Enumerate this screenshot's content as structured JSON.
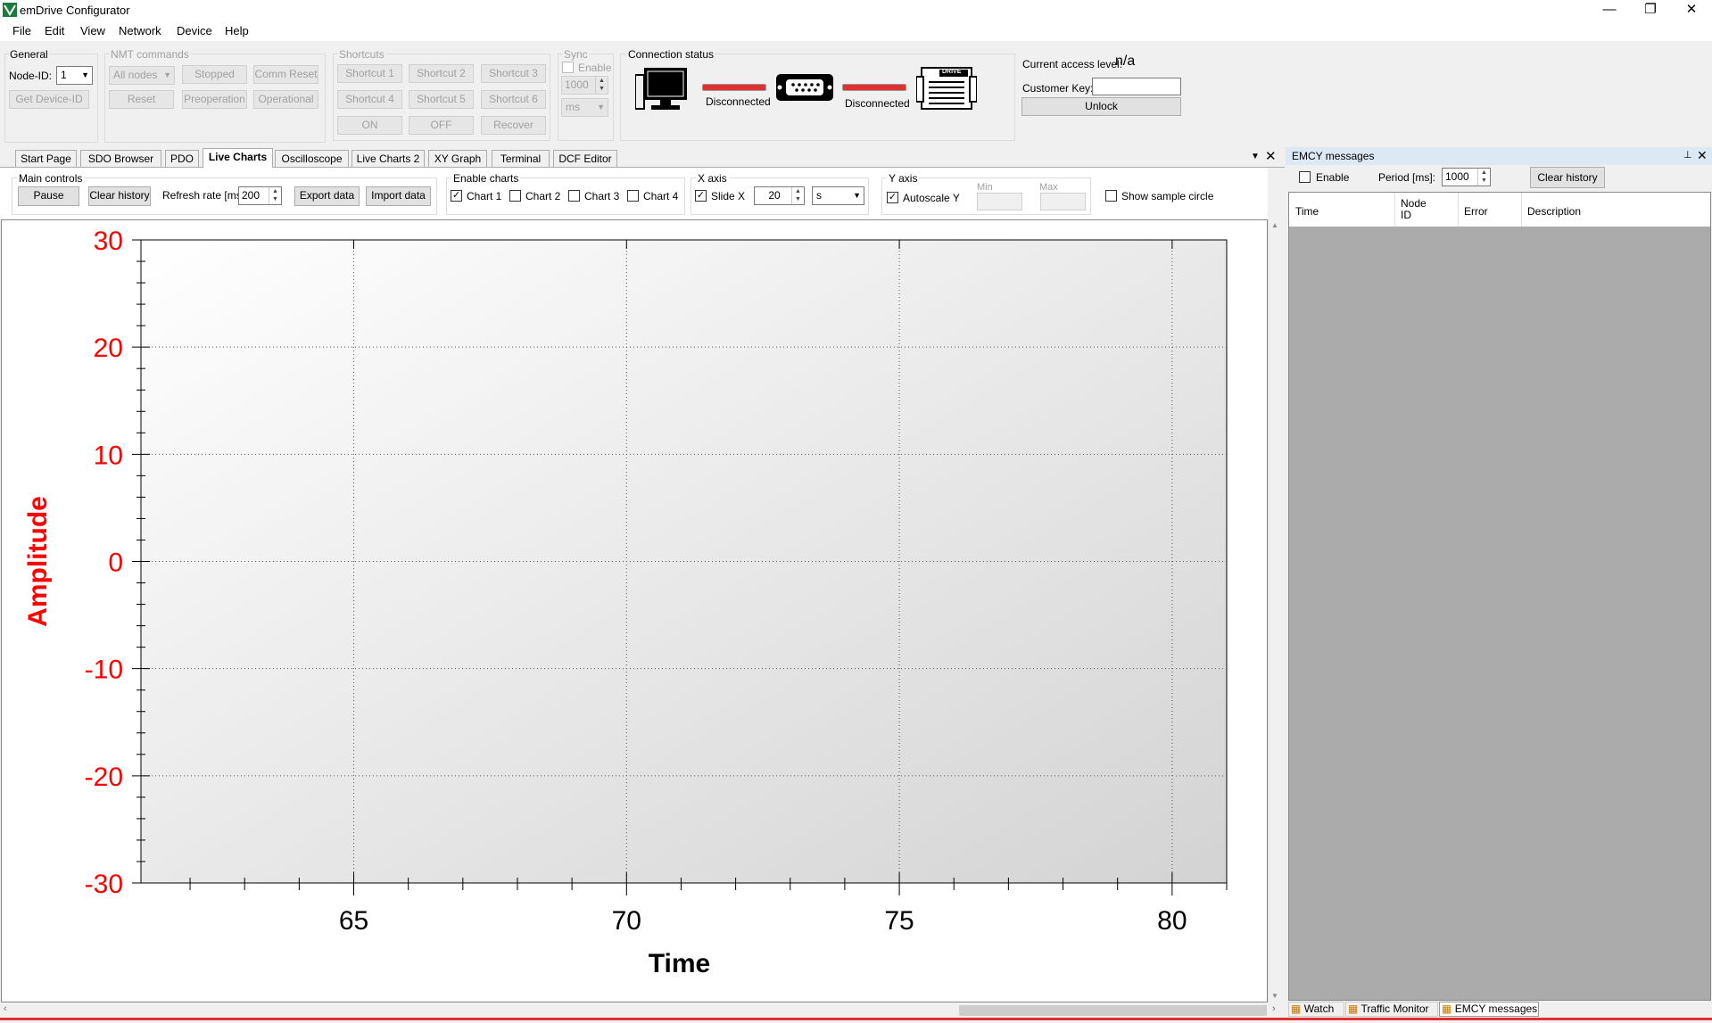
{
  "window": {
    "title": "emDrive Configurator",
    "min": "—",
    "restore": "❐",
    "close": "✕"
  },
  "menu": [
    "File",
    "Edit",
    "View",
    "Network",
    "Device",
    "Help"
  ],
  "general": {
    "label": "General",
    "node_id_label": "Node-ID:",
    "node_id_value": "1",
    "get_device_id": "Get Device-ID"
  },
  "nmt": {
    "label": "NMT commands",
    "nodes": "All nodes",
    "stopped": "Stopped",
    "comm_reset": "Comm Reset",
    "reset": "Reset",
    "preoperation": "Preoperation",
    "operational": "Operational"
  },
  "shortcuts": {
    "label": "Shortcuts",
    "s1": "Shortcut 1",
    "s2": "Shortcut 2",
    "s3": "Shortcut 3",
    "s4": "Shortcut 4",
    "s5": "Shortcut 5",
    "s6": "Shortcut 6",
    "on": "ON",
    "off": "OFF",
    "recover": "Recover"
  },
  "sync": {
    "label": "Sync",
    "enable": "Enable",
    "value": "1000",
    "unit": "ms"
  },
  "connection": {
    "label": "Connection status",
    "status1": "Disconnected",
    "status2": "Disconnected",
    "cable_color": "#e03030",
    "drive_label": "DRIVE"
  },
  "access": {
    "label": "Current access level:",
    "value": "n/a",
    "customer_key_label": "Customer Key:",
    "customer_key_value": "",
    "unlock": "Unlock"
  },
  "tabs": [
    "Start Page",
    "SDO Browser",
    "PDO",
    "Live Charts",
    "Oscilloscope",
    "Live Charts 2",
    "XY Graph",
    "Terminal",
    "DCF Editor"
  ],
  "active_tab": "Live Charts",
  "main_controls": {
    "label": "Main controls",
    "pause": "Pause",
    "clear_history": "Clear history",
    "refresh_label": "Refresh rate [ms]",
    "refresh_value": "200",
    "export": "Export data",
    "import": "Import data"
  },
  "enable_charts": {
    "label": "Enable charts",
    "items": [
      {
        "label": "Chart 1",
        "checked": true
      },
      {
        "label": "Chart 2",
        "checked": false
      },
      {
        "label": "Chart 3",
        "checked": false
      },
      {
        "label": "Chart 4",
        "checked": false
      }
    ]
  },
  "x_axis": {
    "label": "X axis",
    "slide_label": "Slide X",
    "slide_checked": true,
    "value": "20",
    "unit": "s"
  },
  "y_axis": {
    "label": "Y axis",
    "autoscale_label": "Autoscale Y",
    "autoscale_checked": true,
    "min_label": "Min",
    "max_label": "Max"
  },
  "show_sample_circle": "Show sample circle",
  "chart_data": {
    "type": "line",
    "xlabel": "Time",
    "ylabel": "Amplitude",
    "xlim": [
      61.1,
      81.0
    ],
    "ylim": [
      -30,
      30
    ],
    "x_ticks": [
      65,
      70,
      75,
      80
    ],
    "y_ticks": [
      30,
      20,
      10,
      0,
      -10,
      -20,
      -30
    ],
    "grid": true,
    "series": [],
    "ylabel_color": "#ff0000",
    "ytick_color": "#ff0000"
  },
  "emcy": {
    "title": "EMCY messages",
    "enable": "Enable",
    "period_label": "Period [ms]:",
    "period_value": "1000",
    "clear_history": "Clear history",
    "columns": [
      "Time",
      "Node ID",
      "Error",
      "Description"
    ]
  },
  "bottom_tabs": [
    "Watch",
    "Traffic Monitor",
    "EMCY messages"
  ]
}
